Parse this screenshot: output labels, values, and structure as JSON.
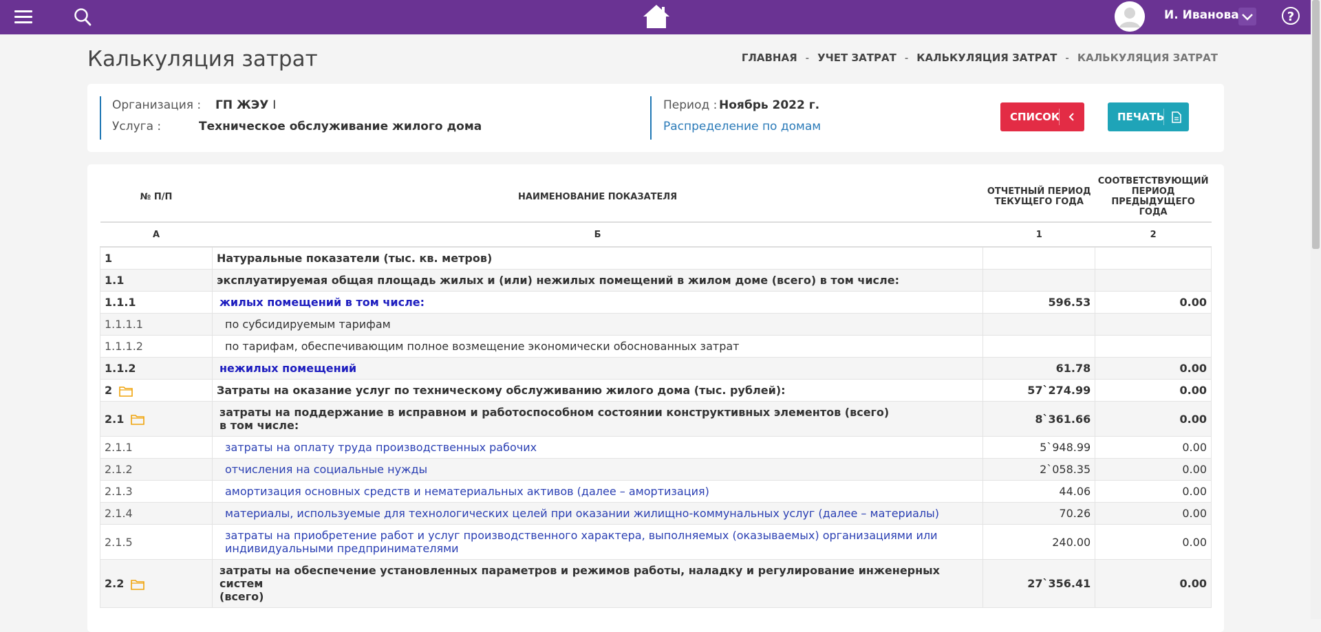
{
  "header": {
    "user_name": "И. Иванова",
    "help": "?"
  },
  "page": {
    "title": "Калькуляция затрат",
    "breadcrumb": [
      "ГЛАВНАЯ",
      "УЧЕТ ЗАТРАТ",
      "КАЛЬКУЛЯЦИЯ ЗАТРАТ",
      "КАЛЬКУЛЯЦИЯ ЗАТРАТ"
    ],
    "sep": "-"
  },
  "info": {
    "org_label": "Организация :",
    "org_value": "ГП ЖЭУ",
    "org_suffix": "I",
    "service_label": "Услуга :",
    "service_value": "Техническое обслуживание жилого дома",
    "period_label": "Период :",
    "period_value": "Ноябрь 2022 г.",
    "distribution_link": "Распределение по домам"
  },
  "buttons": {
    "list": "СПИСОК",
    "print": "ПЕЧАТЬ"
  },
  "table": {
    "headers": {
      "num": "№ П/П",
      "name": "НАИМЕНОВАНИЕ ПОКАЗАТЕЛЯ",
      "cur": "ОТЧЕТНЫЙ ПЕРИОД ТЕКУЩЕГО ГОДА",
      "prev": "СООТВЕТСТВУЮЩИЙ ПЕРИОД ПРЕДЫДУЩЕГО ГОДА"
    },
    "subheaders": [
      "А",
      "Б",
      "1",
      "2"
    ],
    "rows": [
      {
        "n": "1",
        "name": "Натуральные показатели (тыс. кв. метров)",
        "cur": "",
        "prev": ""
      },
      {
        "n": "1.1",
        "name": "эксплуатируемая общая площадь жилых и (или) нежилых помещений в жилом доме (всего) в том числе:",
        "cur": "",
        "prev": ""
      },
      {
        "n": "1.1.1",
        "name": "жилых помещений в том числе:",
        "cur": "596.53",
        "prev": "0.00"
      },
      {
        "n": "1.1.1.1",
        "name": "по субсидируемым тарифам",
        "cur": "",
        "prev": ""
      },
      {
        "n": "1.1.1.2",
        "name": "по тарифам, обеспечивающим полное возмещение экономически обоснованных затрат",
        "cur": "",
        "prev": ""
      },
      {
        "n": "1.1.2",
        "name": "нежилых помещений",
        "cur": "61.78",
        "prev": "0.00"
      },
      {
        "n": "2",
        "name": "Затраты на оказание услуг по техническому обслуживанию жилого дома (тыс. рублей):",
        "cur": "57`274.99",
        "prev": "0.00"
      },
      {
        "n": "2.1",
        "name": "затраты на поддержание в исправном и работоспособном состоянии конструктивных элементов (всего)",
        "name2": "в том числе:",
        "cur": "8`361.66",
        "prev": "0.00"
      },
      {
        "n": "2.1.1",
        "name": "затраты на оплату труда производственных рабочих",
        "cur": "5`948.99",
        "prev": "0.00"
      },
      {
        "n": "2.1.2",
        "name": "отчисления на социальные нужды",
        "cur": "2`058.35",
        "prev": "0.00"
      },
      {
        "n": "2.1.3",
        "name": "амортизация основных средств и нематериальных активов (далее – амортизация)",
        "cur": "44.06",
        "prev": "0.00"
      },
      {
        "n": "2.1.4",
        "name": "материалы, используемые для технологических целей при оказании жилищно-коммунальных услуг (далее – материалы)",
        "cur": "70.26",
        "prev": "0.00"
      },
      {
        "n": "2.1.5",
        "name": "затраты на приобретение работ и услуг производственного характера, выполняемых (оказываемых) организациями или",
        "name2": "индивидуальными предпринимателями",
        "cur": "240.00",
        "prev": "0.00"
      },
      {
        "n": "2.2",
        "name": "затраты на обеспечение установленных параметров и режимов работы, наладку и регулирование инженерных систем",
        "name2": "(всего)",
        "cur": "27`356.41",
        "prev": "0.00"
      }
    ]
  }
}
